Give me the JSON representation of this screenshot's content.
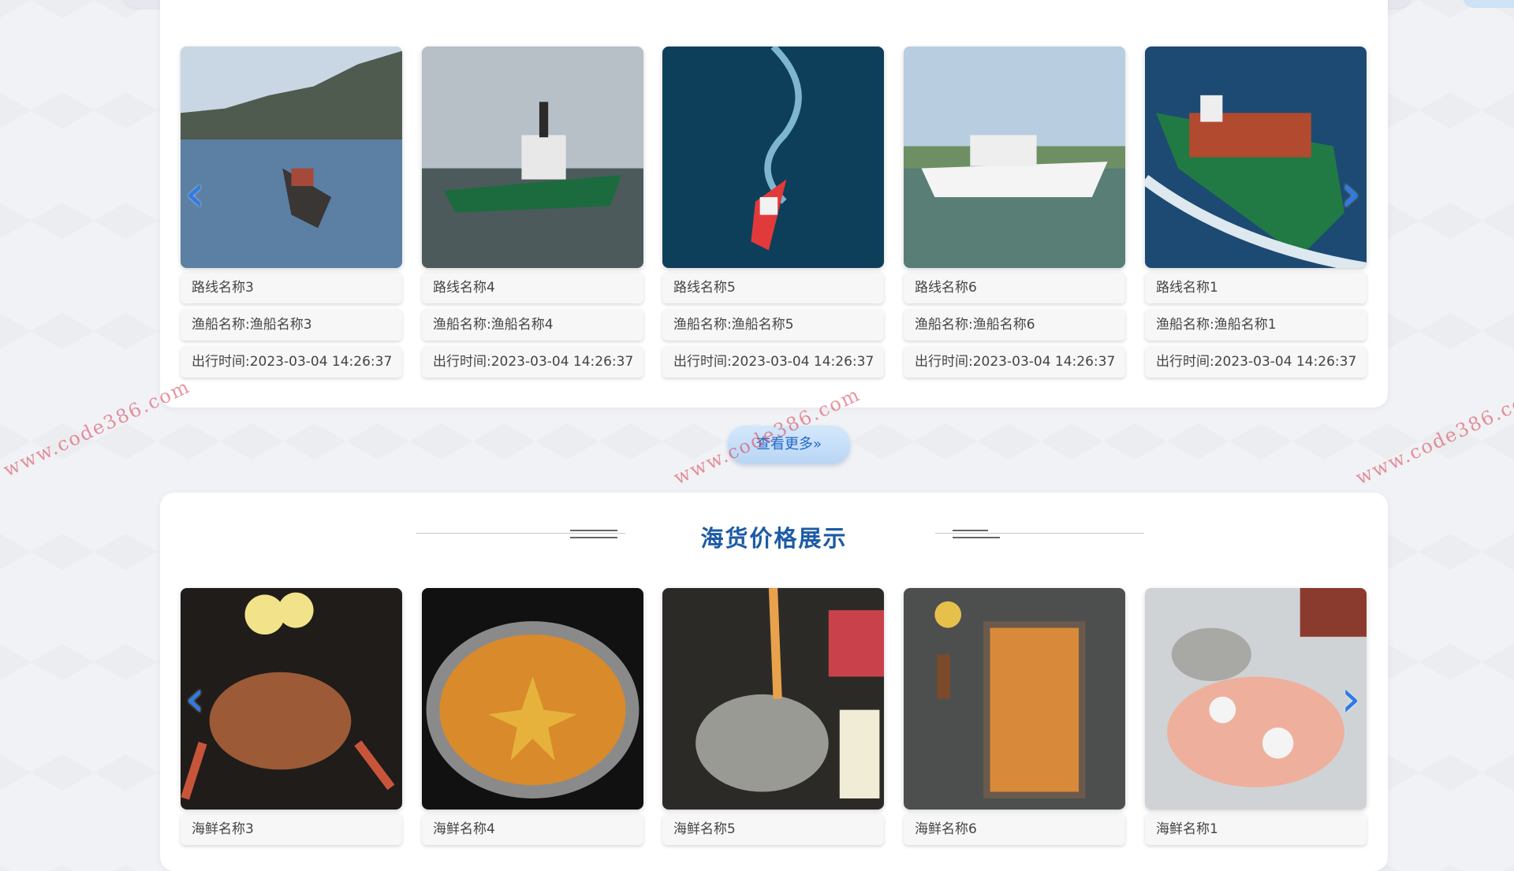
{
  "routes": {
    "cards": [
      {
        "route": "路线名称3",
        "boat": "渔船名称:渔船名称3",
        "time": "出行时间:2023-03-04 14:26:37"
      },
      {
        "route": "路线名称4",
        "boat": "渔船名称:渔船名称4",
        "time": "出行时间:2023-03-04 14:26:37"
      },
      {
        "route": "路线名称5",
        "boat": "渔船名称:渔船名称5",
        "time": "出行时间:2023-03-04 14:26:37"
      },
      {
        "route": "路线名称6",
        "boat": "渔船名称:渔船名称6",
        "time": "出行时间:2023-03-04 14:26:37"
      },
      {
        "route": "路线名称1",
        "boat": "渔船名称:渔船名称1",
        "time": "出行时间:2023-03-04 14:26:37"
      }
    ],
    "prev_icon": "chevron-left-icon",
    "next_icon": "chevron-right-icon"
  },
  "more_button": "查看更多»",
  "seafood": {
    "title": "海货价格展示",
    "cards": [
      {
        "name": "海鲜名称3"
      },
      {
        "name": "海鲜名称4"
      },
      {
        "name": "海鲜名称5"
      },
      {
        "name": "海鲜名称6"
      },
      {
        "name": "海鲜名称1"
      }
    ]
  },
  "watermark": "www.code386.com",
  "colors": {
    "accent": "#1d5ba5",
    "arrow": "#2d7be8",
    "button": "#c6def7"
  }
}
